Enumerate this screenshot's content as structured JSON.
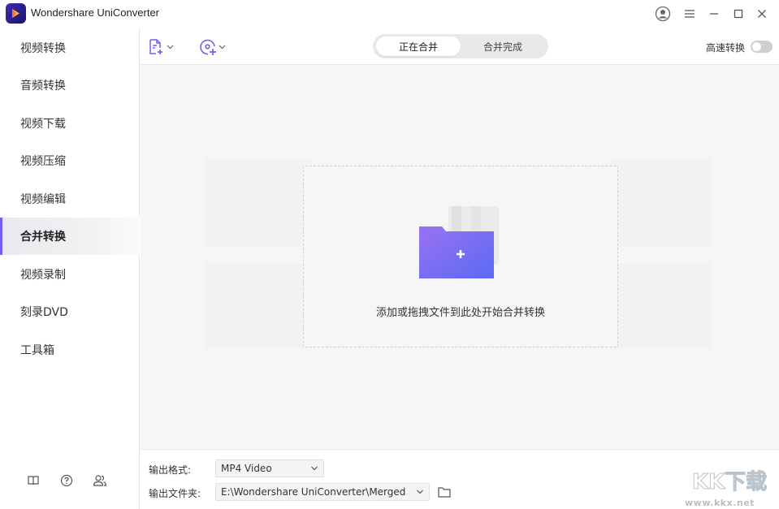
{
  "app": {
    "title": "Wondershare UniConverter"
  },
  "sidebar": {
    "items": [
      {
        "label": "视频转换",
        "active": false
      },
      {
        "label": "音频转换",
        "active": false
      },
      {
        "label": "视频下载",
        "active": false
      },
      {
        "label": "视频压缩",
        "active": false
      },
      {
        "label": "视频编辑",
        "active": false
      },
      {
        "label": "合并转换",
        "active": true
      },
      {
        "label": "视频录制",
        "active": false
      },
      {
        "label": "刻录DVD",
        "active": false
      },
      {
        "label": "工具箱",
        "active": false
      }
    ],
    "bottom_icons": [
      "book-icon",
      "help-icon",
      "users-icon"
    ]
  },
  "toolbar": {
    "add_file_icon": "add-file-icon",
    "add_disc_icon": "add-disc-icon",
    "tabs": [
      {
        "label": "正在合并",
        "active": true
      },
      {
        "label": "合并完成",
        "active": false
      }
    ],
    "high_speed_label": "高速转换",
    "high_speed_on": false
  },
  "dropzone": {
    "text": "添加或拖拽文件到此处开始合并转换"
  },
  "output": {
    "format_label": "输出格式:",
    "format_value": "MP4 Video",
    "folder_label": "输出文件夹:",
    "folder_value": "E:\\Wondershare UniConverter\\Merged"
  },
  "watermark": {
    "text": "KK下载",
    "url": "www.kkx.net"
  },
  "colors": {
    "accent": "#7c5bf0",
    "folder": "#7b6cf0"
  }
}
